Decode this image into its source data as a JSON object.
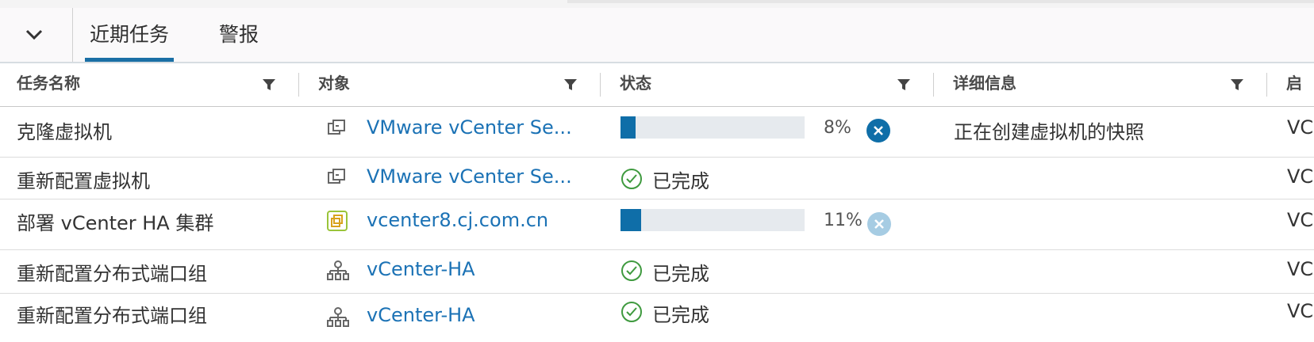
{
  "tabs": [
    {
      "label": "近期任务",
      "active": true
    },
    {
      "label": "警报",
      "active": false
    }
  ],
  "columns": [
    "任务名称",
    "对象",
    "状态",
    "详细信息",
    "启动"
  ],
  "rows": [
    {
      "task": "克隆虚拟机",
      "object_icon": "vm-icon",
      "object": "VMware vCenter Se...",
      "status_type": "progress",
      "progress": "8%",
      "progress_value": 0.08,
      "details": "正在创建虚拟机的快照",
      "last": "VC"
    },
    {
      "task": "重新配置虚拟机",
      "object_icon": "vm-icon",
      "object": "VMware vCenter Se...",
      "status_type": "done",
      "status": "已完成",
      "details": "",
      "last": "VC"
    },
    {
      "task": "部署 vCenter HA 集群",
      "object_icon": "vcenter-icon",
      "object": "vcenter8.cj.com.cn",
      "status_type": "progress",
      "progress": "11%",
      "progress_value": 0.11,
      "details": "",
      "last": "VC"
    },
    {
      "task": "重新配置分布式端口组",
      "object_icon": "port-group-icon",
      "object": "vCenter-HA",
      "status_type": "done",
      "status": "已完成",
      "details": "",
      "last": "VC"
    },
    {
      "task": "重新配置分布式端口组",
      "object_icon": "port-group-icon",
      "object": "vCenter-HA",
      "status_type": "done",
      "status": "已完成",
      "details": "",
      "last": "VC"
    }
  ],
  "colors": {
    "accent": "#1a6fa5",
    "link": "#1b72b5",
    "progress": "#0f6ea8",
    "success": "#3f9a3f"
  }
}
